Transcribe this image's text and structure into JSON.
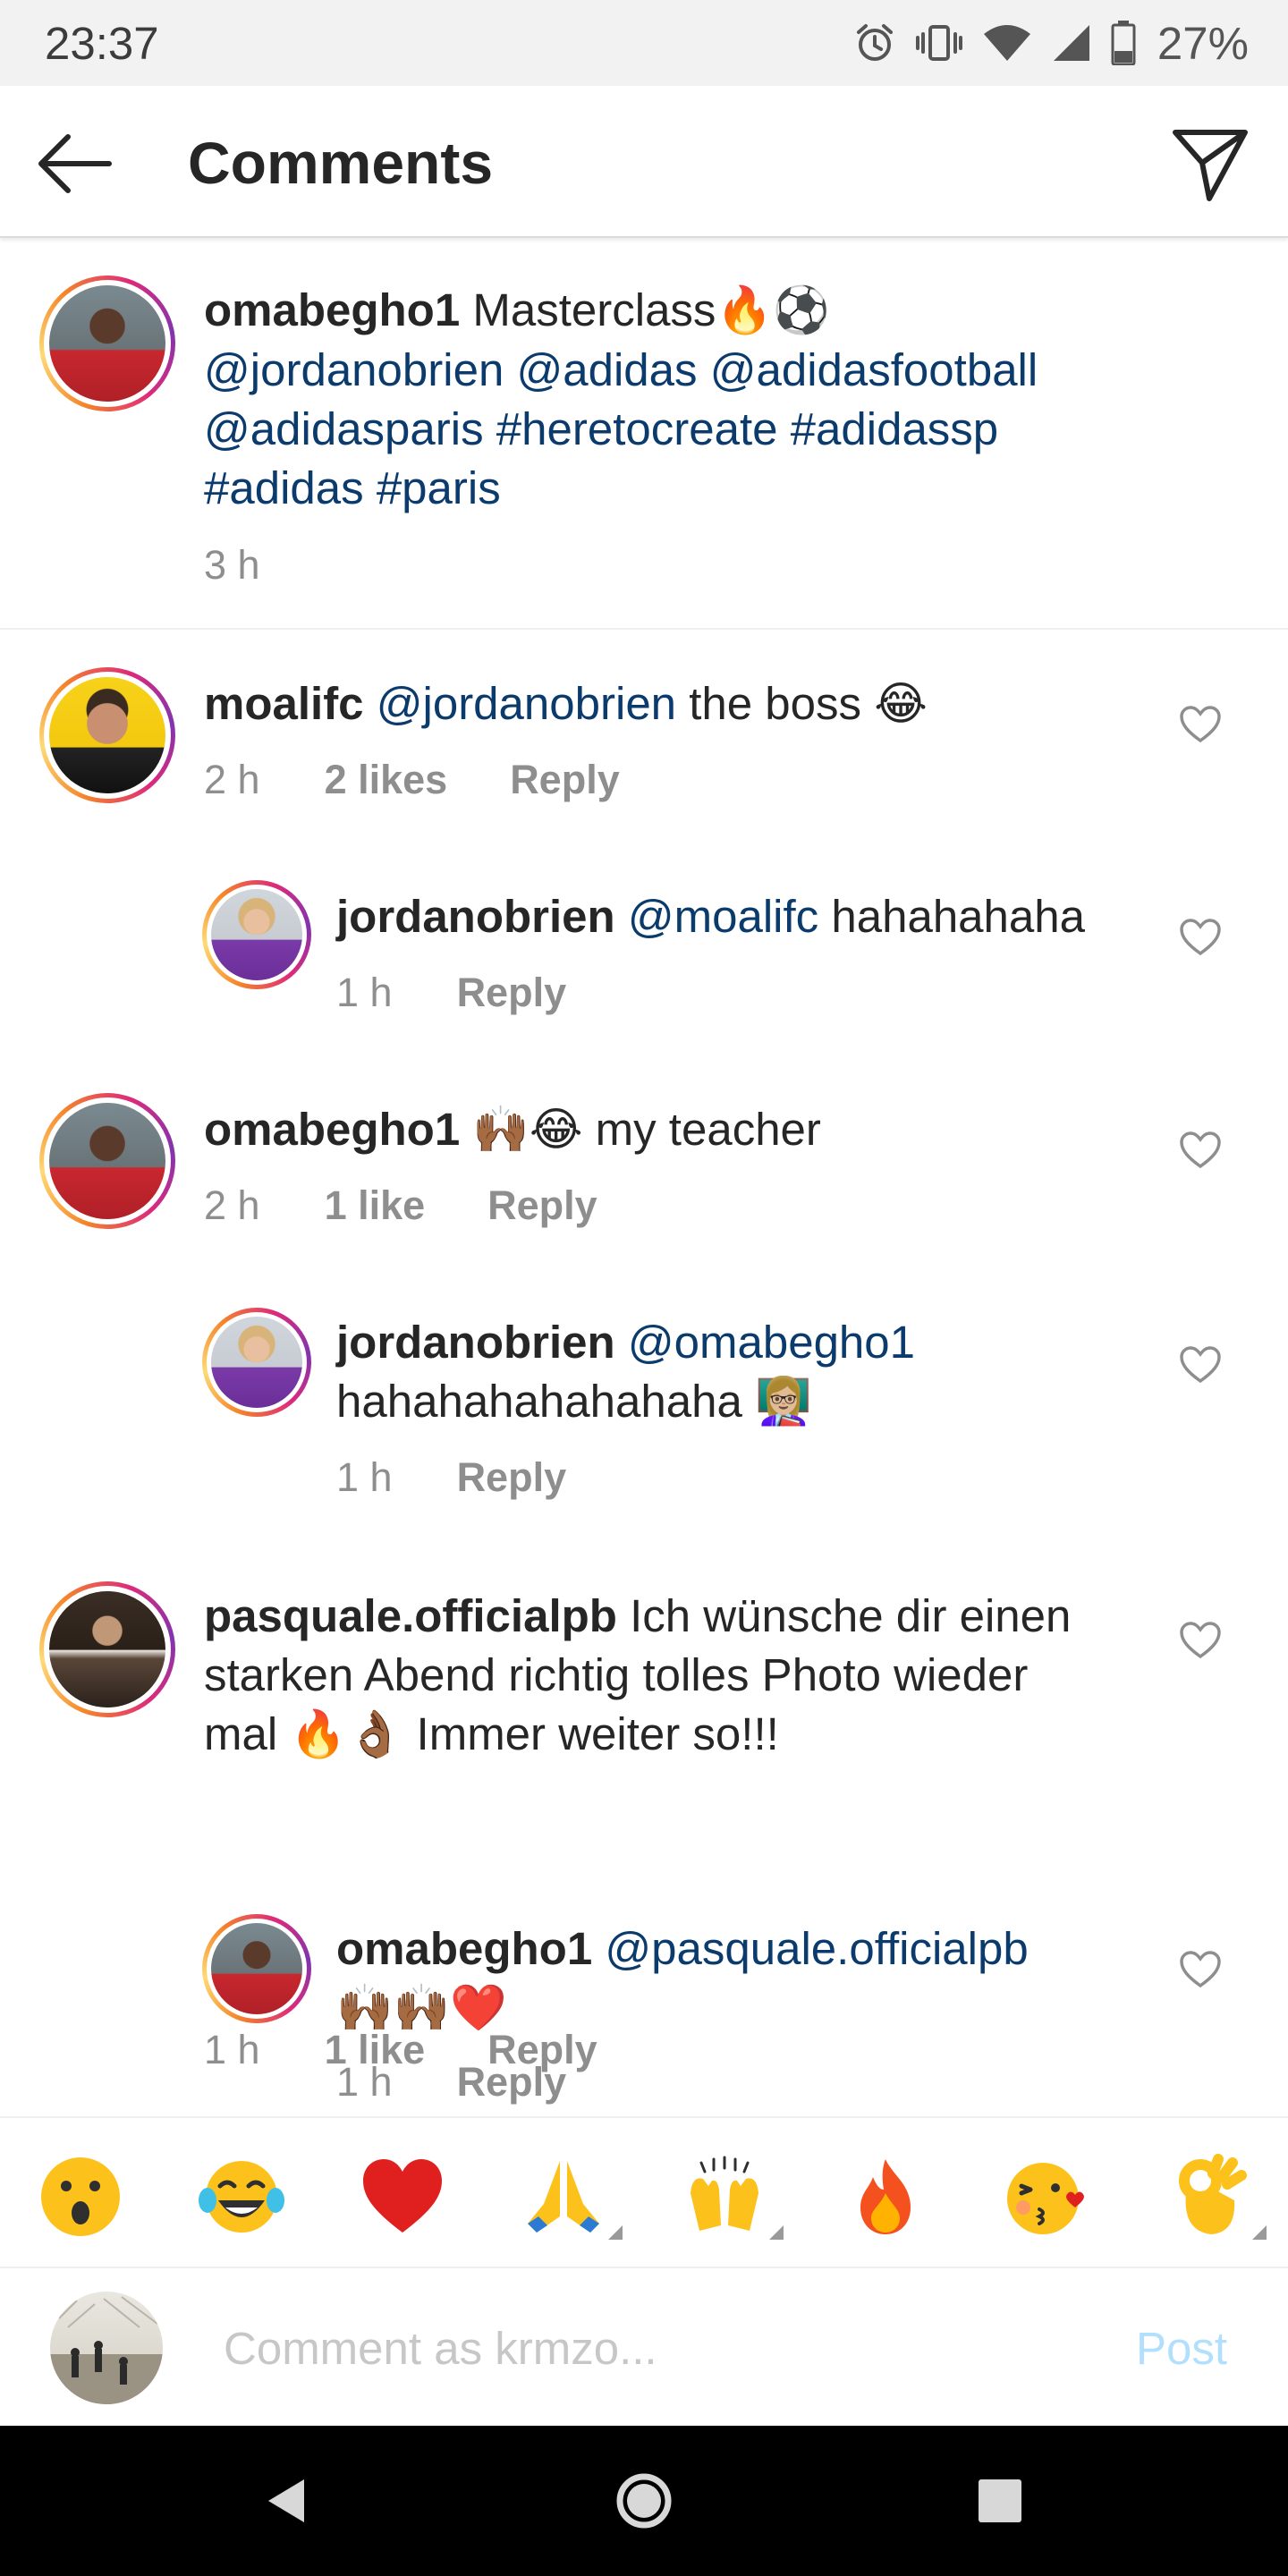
{
  "status_bar": {
    "time": "23:37",
    "battery": "27%",
    "icons": [
      "alarm-icon",
      "vibrate-icon",
      "wifi-icon",
      "signal-icon",
      "battery-icon"
    ]
  },
  "header": {
    "title": "Comments",
    "back_icon": "arrow-left-icon",
    "send_icon": "paper-plane-icon"
  },
  "caption": {
    "username": "omabegho1",
    "text": "Masterclass",
    "emojis": "🔥⚽",
    "line2": "@jordanobrien @adidas @adidasfootball",
    "line3": "@adidasparis #heretocreate #adidassp",
    "line4": "#adidas #paris",
    "time": "3 h"
  },
  "comments": [
    {
      "username": "moalifc",
      "mention": "@jordanobrien",
      "text": "the boss",
      "emoji": "😂",
      "time": "2 h",
      "likes": "2 likes",
      "reply": "Reply"
    },
    {
      "username": "jordanobrien",
      "mention": "@moalifc",
      "text": "hahahahaha",
      "time": "1 h",
      "reply": "Reply"
    },
    {
      "username": "omabegho1",
      "emoji": "🙌🏾😂",
      "text": "my teacher",
      "time": "2 h",
      "likes": "1 like",
      "reply": "Reply"
    },
    {
      "username": "jordanobrien",
      "mention": "@omabegho1",
      "text": "hahahahahahahaha",
      "emoji": "👩🏼‍🏫",
      "time": "1 h",
      "reply": "Reply"
    },
    {
      "username": "pasquale.officialpb",
      "text_line1": "Ich wünsche dir einen",
      "text_line2": "starken Abend richtig tolles Photo wieder",
      "text_line3_a": "mal",
      "emoji": "🔥👌🏾",
      "text_line3_b": "Immer weiter so!!!",
      "time": "1 h",
      "likes": "1 like",
      "reply": "Reply"
    },
    {
      "username": "omabegho1",
      "mention": "@pasquale.officialpb",
      "emoji": "🙌🏾🙌🏾❤️",
      "time": "1 h",
      "reply": "Reply"
    }
  ],
  "emoji_bar": [
    "hushed-face",
    "tears-of-joy-face",
    "red-heart",
    "folded-hands",
    "raising-hands",
    "fire",
    "face-blowing-kiss",
    "ok-hand"
  ],
  "composer": {
    "placeholder": "Comment as krmzo...",
    "post_label": "Post"
  },
  "nav": {
    "back_icon": "nav-back-icon",
    "home_icon": "nav-home-icon",
    "recents_icon": "nav-recents-icon"
  },
  "colors": {
    "mention": "#0b3b6d",
    "meta": "#8e8e8e",
    "post_disabled": "#b2dffc",
    "story_ring_start": "#f58529",
    "story_ring_end": "#8134af"
  }
}
